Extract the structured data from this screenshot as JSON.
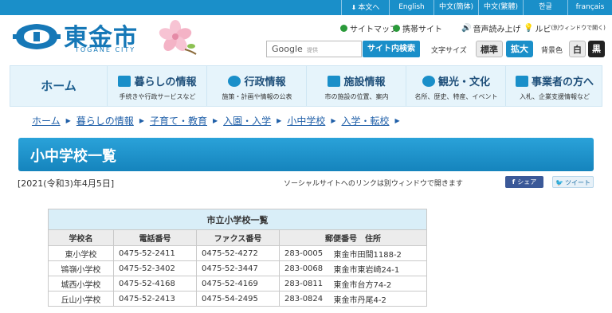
{
  "top_links": [
    {
      "label": "本文へ",
      "icon": "download-icon"
    },
    {
      "label": "English"
    },
    {
      "label": "中文(簡体)"
    },
    {
      "label": "中文(繁體)"
    },
    {
      "label": "한글"
    },
    {
      "label": "français"
    }
  ],
  "logo": {
    "name": "東金市",
    "sub": "TOGANE CITY"
  },
  "utility": {
    "sitemap": "サイトマップ",
    "mobile": "携帯サイト",
    "voice": "音声読み上げ",
    "ruby": "ルビ",
    "ruby_note": "(別ウィンドウで開く)"
  },
  "search": {
    "google": "Google",
    "provided": "提供",
    "button": "サイト内検索"
  },
  "text_size": {
    "label": "文字サイズ",
    "normal": "標準",
    "large": "拡大"
  },
  "bg_color": {
    "label": "背景色",
    "white": "白",
    "black": "黒"
  },
  "nav": {
    "home": "ホーム",
    "items": [
      {
        "title": "暮らしの情報",
        "sub": "手続きや行政サービスなど",
        "icon": "house-icon"
      },
      {
        "title": "行政情報",
        "sub": "施策・計画や情報の公表",
        "icon": "city-emblem-icon"
      },
      {
        "title": "施設情報",
        "sub": "市の施設の位置、案内",
        "icon": "building-icon"
      },
      {
        "title": "観光・文化",
        "sub": "名所、歴史、特産、イベント",
        "icon": "sightseeing-icon"
      },
      {
        "title": "事業者の方へ",
        "sub": "入札、企業支援情報など",
        "icon": "briefcase-icon"
      }
    ]
  },
  "breadcrumb": [
    "ホーム",
    "暮らしの情報",
    "子育て・教育",
    "入園・入学",
    "小中学校",
    "入学・転校"
  ],
  "page": {
    "title": "小中学校一覧",
    "date": "[2021(令和3)年4月5日]",
    "social_note": "ソーシャルサイトへのリンクは別ウィンドウで開きます",
    "share": "シェア",
    "tweet": "ツイート"
  },
  "table": {
    "caption": "市立小学校一覧",
    "headers": [
      "学校名",
      "電話番号",
      "ファクス番号",
      "郵便番号　住所"
    ],
    "rows": [
      [
        "東小学校",
        "0475-52-2411",
        "0475-52-4272",
        "283-0005",
        "東金市田間1188-2"
      ],
      [
        "鴇嶺小学校",
        "0475-52-3402",
        "0475-52-3447",
        "283-0068",
        "東金市東岩崎24-1"
      ],
      [
        "城西小学校",
        "0475-52-4168",
        "0475-52-4169",
        "283-0811",
        "東金市台方74-2"
      ],
      [
        "丘山小学校",
        "0475-52-2413",
        "0475-54-2495",
        "283-0824",
        "東金市丹尾4-2"
      ]
    ]
  },
  "colors": {
    "primary": "#1a8fc9",
    "nav_bg": "#e6f4fb",
    "link": "#1f5fa8",
    "facebook": "#3b5998"
  }
}
